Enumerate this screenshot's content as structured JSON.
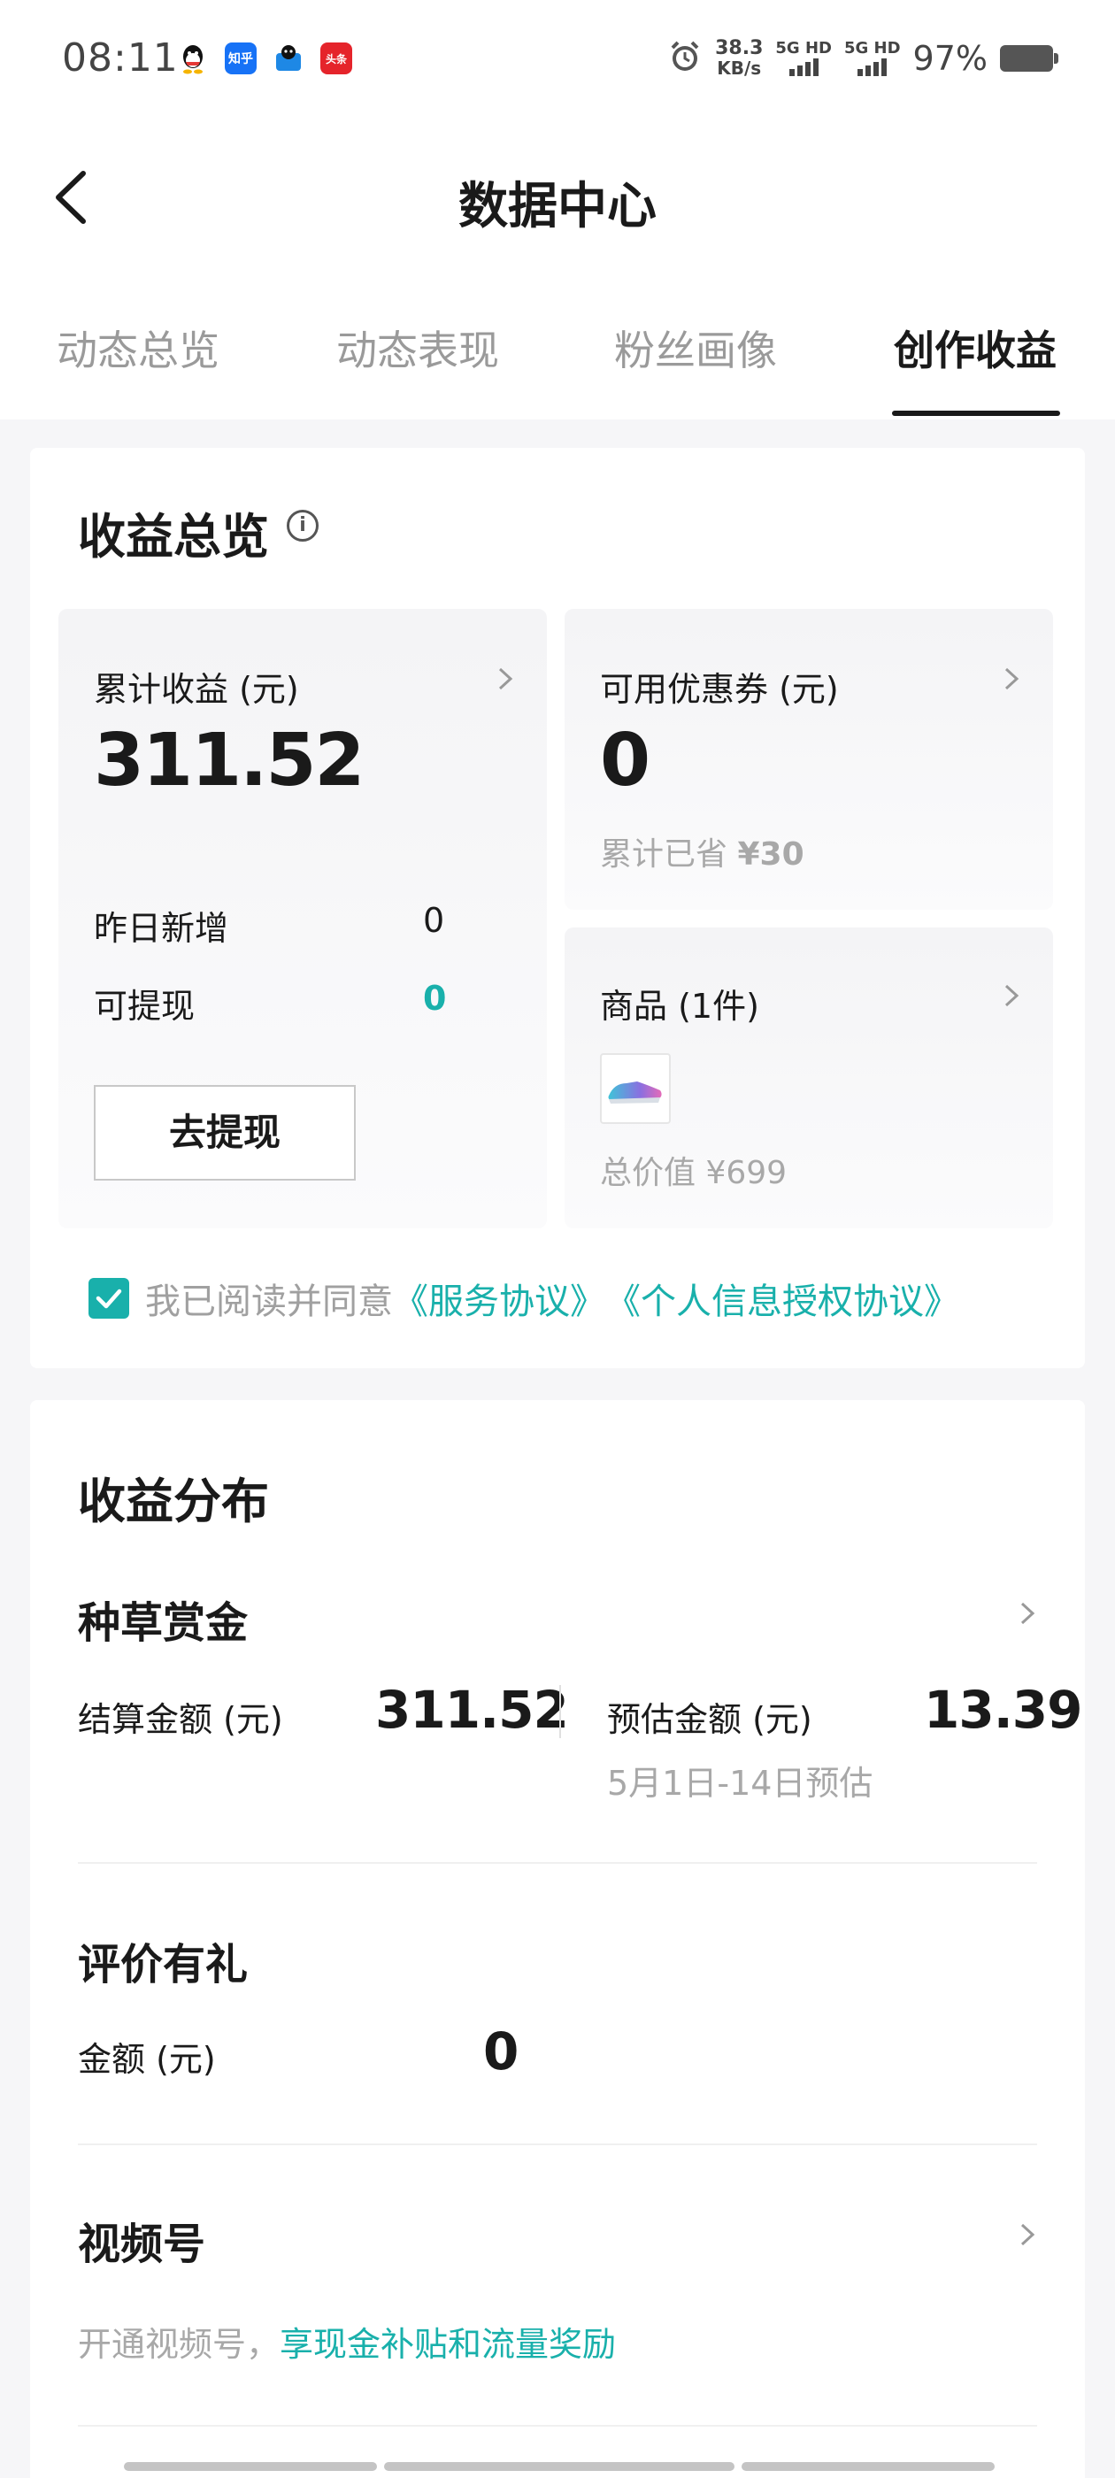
{
  "status_bar": {
    "time": "08:11",
    "app_icons": [
      "qq-icon",
      "zhihu-icon",
      "qq-reader-icon",
      "toutiao-icon"
    ],
    "app_icon_labels": {
      "zhihu": "知乎",
      "toutiao": "头条"
    },
    "net_speed_value": "38.3",
    "net_speed_unit": "KB/s",
    "network_1": "5G HD",
    "network_2": "5G HD",
    "battery": "97%"
  },
  "header": {
    "title": "数据中心"
  },
  "tabs": [
    {
      "label": "动态总览",
      "active": false
    },
    {
      "label": "动态表现",
      "active": false
    },
    {
      "label": "粉丝画像",
      "active": false
    },
    {
      "label": "创作收益",
      "active": true
    }
  ],
  "overview": {
    "title": "收益总览",
    "info_symbol": "i",
    "total_income": {
      "label": "累计收益 (元)",
      "value": "311.52",
      "yesterday_label": "昨日新增",
      "yesterday_value": "0",
      "withdrawable_label": "可提现",
      "withdrawable_value": "0",
      "withdraw_button": "去提现"
    },
    "coupon": {
      "label": "可用优惠券 (元)",
      "value": "0",
      "saved_label": "累计已省",
      "saved_value": "¥30"
    },
    "goods": {
      "label": "商品 (1件)",
      "total_value": "总价值 ¥699"
    },
    "agreement": {
      "checked": true,
      "text": "我已阅读并同意",
      "link1": "《服务协议》",
      "link2": "《个人信息授权协议》"
    }
  },
  "distribution": {
    "title": "收益分布",
    "seeding_bounty": {
      "title": "种草赏金",
      "settled_label": "结算金额 (元)",
      "settled_value": "311.52",
      "estimated_label": "预估金额 (元)",
      "estimated_value": "13.39",
      "estimated_note": "5月1日-14日预估"
    },
    "review_gift": {
      "title": "评价有礼",
      "amount_label": "金额 (元)",
      "amount_value": "0"
    },
    "video_account": {
      "title": "视频号",
      "desc_prefix": "开通视频号，",
      "desc_link": "享现金补贴和流量奖励"
    }
  },
  "colors": {
    "accent": "#19b0ab",
    "text": "#1a1a1a",
    "muted": "#a8a8a8",
    "background": "#f6f6f8"
  }
}
